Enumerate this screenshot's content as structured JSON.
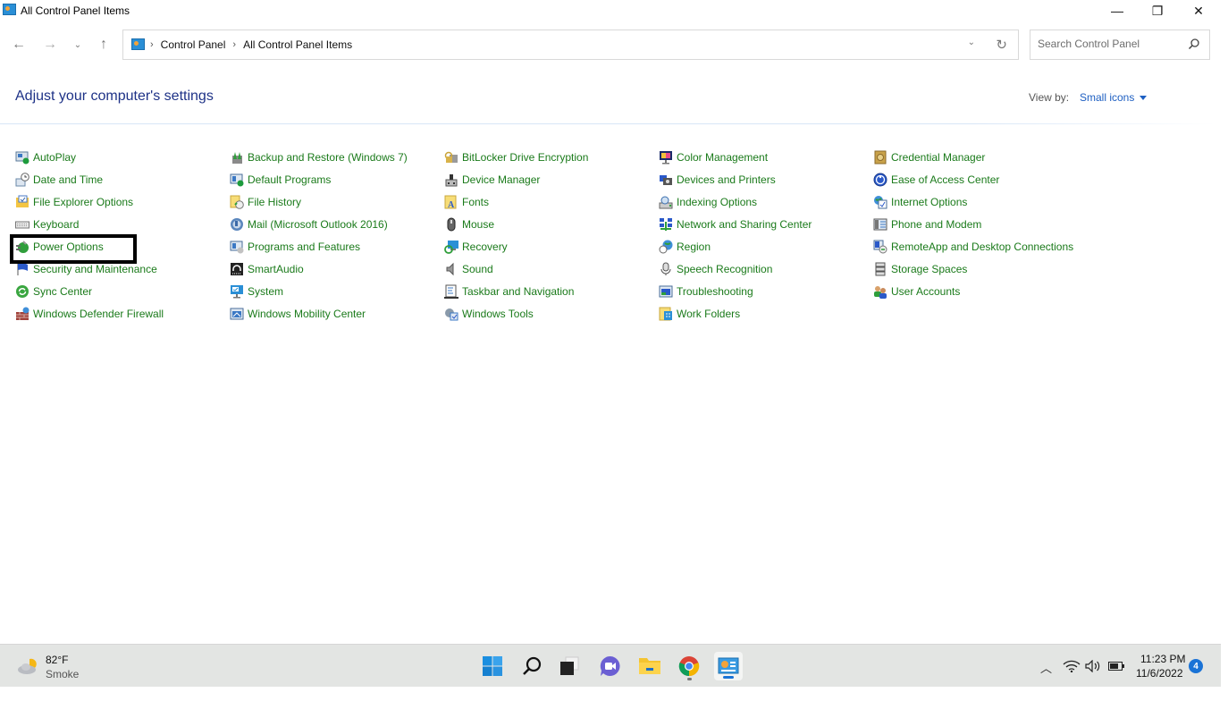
{
  "window": {
    "title": "All Control Panel Items",
    "controls": {
      "minimize": "—",
      "maximize": "❐",
      "close": "✕"
    }
  },
  "nav": {
    "back": "←",
    "forward": "→",
    "recent": "⌄",
    "up": "↑"
  },
  "address": {
    "crumbs": [
      "Control Panel",
      "All Control Panel Items"
    ],
    "separator": "›",
    "dropdown": "⌄",
    "refresh": "↻"
  },
  "search": {
    "placeholder": "Search Control Panel",
    "value": ""
  },
  "heading": "Adjust your computer's settings",
  "view_by": {
    "label": "View by:",
    "value": "Small icons"
  },
  "link_color": "#1a7a1a",
  "columns": [
    [
      {
        "label": "AutoPlay",
        "icon": "autoplay-icon"
      },
      {
        "label": "Date and Time",
        "icon": "clock-icon"
      },
      {
        "label": "File Explorer Options",
        "icon": "folder-options-icon"
      },
      {
        "label": "Keyboard",
        "icon": "keyboard-icon"
      },
      {
        "label": "Power Options",
        "icon": "power-plug-icon"
      },
      {
        "label": "Security and Maintenance",
        "icon": "flag-icon"
      },
      {
        "label": "Sync Center",
        "icon": "sync-icon"
      },
      {
        "label": "Windows Defender Firewall",
        "icon": "firewall-icon"
      }
    ],
    [
      {
        "label": "Backup and Restore (Windows 7)",
        "icon": "backup-icon"
      },
      {
        "label": "Default Programs",
        "icon": "default-programs-icon"
      },
      {
        "label": "File History",
        "icon": "file-history-icon"
      },
      {
        "label": "Mail (Microsoft Outlook 2016)",
        "icon": "mail-icon"
      },
      {
        "label": "Programs and Features",
        "icon": "programs-icon"
      },
      {
        "label": "SmartAudio",
        "icon": "headphones-icon"
      },
      {
        "label": "System",
        "icon": "monitor-icon"
      },
      {
        "label": "Windows Mobility Center",
        "icon": "mobility-icon"
      }
    ],
    [
      {
        "label": "BitLocker Drive Encryption",
        "icon": "bitlocker-icon"
      },
      {
        "label": "Device Manager",
        "icon": "device-manager-icon"
      },
      {
        "label": "Fonts",
        "icon": "fonts-icon"
      },
      {
        "label": "Mouse",
        "icon": "mouse-icon"
      },
      {
        "label": "Recovery",
        "icon": "recovery-icon"
      },
      {
        "label": "Sound",
        "icon": "speaker-icon"
      },
      {
        "label": "Taskbar and Navigation",
        "icon": "taskbar-icon"
      },
      {
        "label": "Windows Tools",
        "icon": "tools-icon"
      }
    ],
    [
      {
        "label": "Color Management",
        "icon": "color-icon"
      },
      {
        "label": "Devices and Printers",
        "icon": "printer-icon"
      },
      {
        "label": "Indexing Options",
        "icon": "indexing-icon"
      },
      {
        "label": "Network and Sharing Center",
        "icon": "network-icon"
      },
      {
        "label": "Region",
        "icon": "globe-clock-icon"
      },
      {
        "label": "Speech Recognition",
        "icon": "microphone-icon"
      },
      {
        "label": "Troubleshooting",
        "icon": "troubleshoot-icon"
      },
      {
        "label": "Work Folders",
        "icon": "work-folders-icon"
      }
    ],
    [
      {
        "label": "Credential Manager",
        "icon": "vault-icon"
      },
      {
        "label": "Ease of Access Center",
        "icon": "ease-of-access-icon"
      },
      {
        "label": "Internet Options",
        "icon": "internet-options-icon"
      },
      {
        "label": "Phone and Modem",
        "icon": "phone-icon"
      },
      {
        "label": "RemoteApp and Desktop Connections",
        "icon": "remoteapp-icon"
      },
      {
        "label": "Storage Spaces",
        "icon": "storage-icon"
      },
      {
        "label": "User Accounts",
        "icon": "users-icon"
      }
    ]
  ],
  "taskbar": {
    "weather": {
      "temp": "82°F",
      "desc": "Smoke"
    },
    "apps": [
      "start",
      "search",
      "task-view",
      "teams-chat",
      "file-explorer",
      "chrome",
      "control-panel"
    ],
    "clock": {
      "time": "11:23 PM",
      "date": "11/6/2022"
    },
    "notifications": "4",
    "tray": {
      "chevron": "︿"
    }
  }
}
